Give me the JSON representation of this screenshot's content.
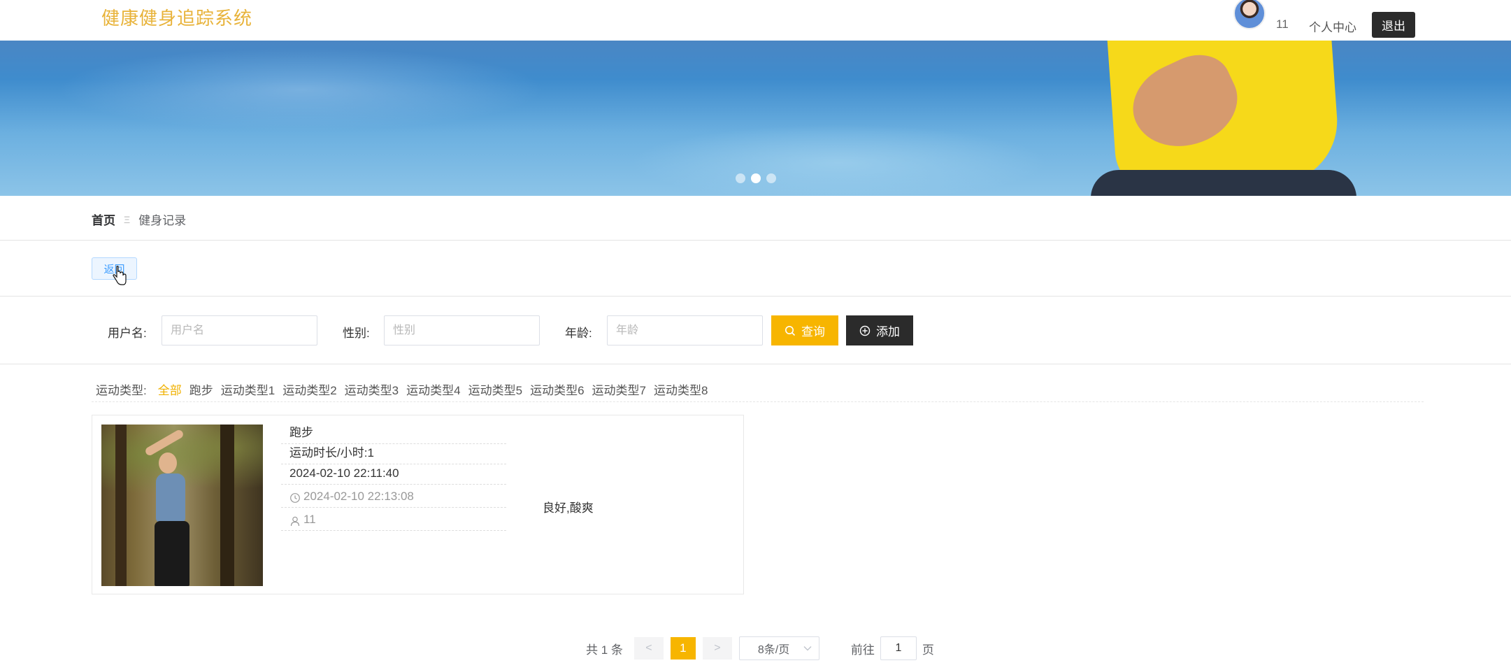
{
  "header": {
    "brand": "健康健身追踪系统",
    "user_id": "11",
    "center_label": "个人中心",
    "logout_label": "退出"
  },
  "banner": {
    "slide_count": 3,
    "active_slide": 2
  },
  "breadcrumb": {
    "home": "首页",
    "separator": "Ξ",
    "current": "健身记录"
  },
  "back_label": "返回",
  "search": {
    "username_label": "用户名:",
    "username_placeholder": "用户名",
    "gender_label": "性别:",
    "gender_placeholder": "性别",
    "age_label": "年龄:",
    "age_placeholder": "年龄",
    "query_label": "查询",
    "add_label": "添加"
  },
  "categories": {
    "label": "运动类型:",
    "items": [
      "全部",
      "跑步",
      "运动类型1",
      "运动类型2",
      "运动类型3",
      "运动类型4",
      "运动类型5",
      "运动类型6",
      "运动类型7",
      "运动类型8"
    ],
    "active": "全部"
  },
  "record": {
    "type": "跑步",
    "duration": "运动时长/小时:1",
    "exercise_time": "2024-02-10 22:11:40",
    "created_time": "2024-02-10 22:13:08",
    "user": "11",
    "remark": "良好,酸爽"
  },
  "pagination": {
    "total": "共 1 条",
    "prev": "<",
    "current_page": "1",
    "next": ">",
    "page_size": "8条/页",
    "goto_label": "前往",
    "goto_value": "1",
    "page_suffix": "页"
  },
  "colors": {
    "accent": "#f7b500",
    "brand": "#e8b33a",
    "dark": "#2b2b2b"
  }
}
